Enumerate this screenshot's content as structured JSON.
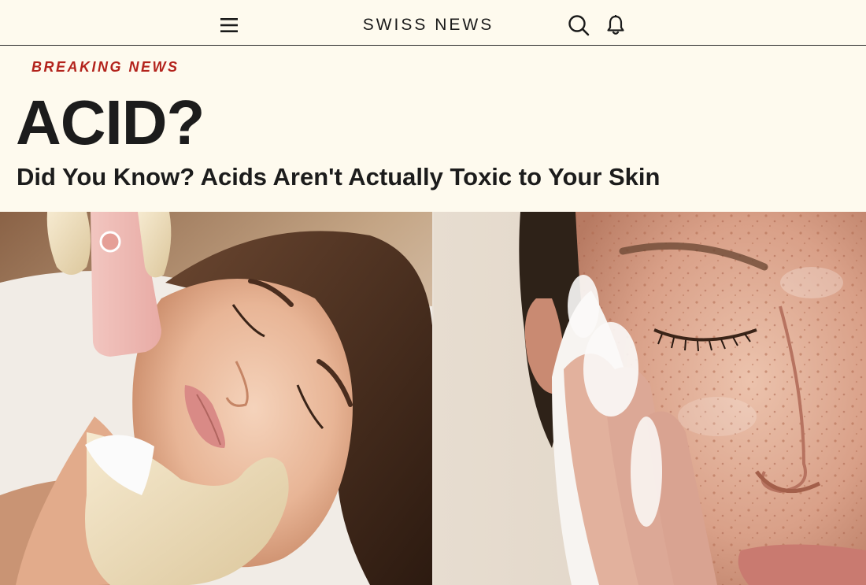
{
  "header": {
    "brand": "SWISS NEWS",
    "menu_icon": "hamburger-menu-icon",
    "search_icon": "search-icon",
    "notification_icon": "bell-icon"
  },
  "article": {
    "kicker": "BREAKING NEWS",
    "headline": "ACID?",
    "subheadline": "Did You Know? Acids Aren't Actually Toxic to Your Skin"
  },
  "hero_images": [
    {
      "subject": "woman receiving ultrasonic facial treatment with gloved hands"
    },
    {
      "subject": "freckled face being washed with foam cleanser"
    }
  ],
  "colors": {
    "background": "#fefaee",
    "kicker": "#b3231c",
    "text": "#1c1c1c"
  }
}
